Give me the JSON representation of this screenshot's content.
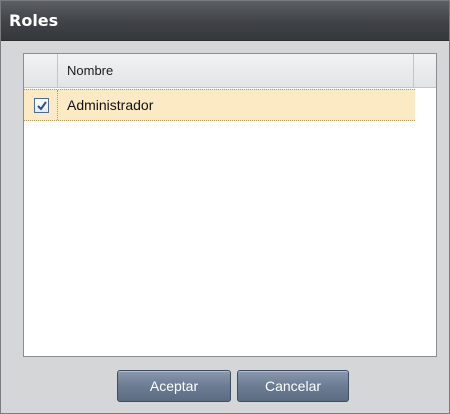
{
  "window": {
    "title": "Roles"
  },
  "grid": {
    "columns": [
      "Nombre"
    ],
    "rows": [
      {
        "checked": true,
        "name": "Administrador"
      }
    ]
  },
  "buttons": {
    "accept_label": "Aceptar",
    "cancel_label": "Cancelar"
  },
  "colors": {
    "titlebar": "#3f4246",
    "selected_row": "#fbeac3",
    "button": "#6b7c93",
    "checkbox_mark": "#2c4f86"
  }
}
